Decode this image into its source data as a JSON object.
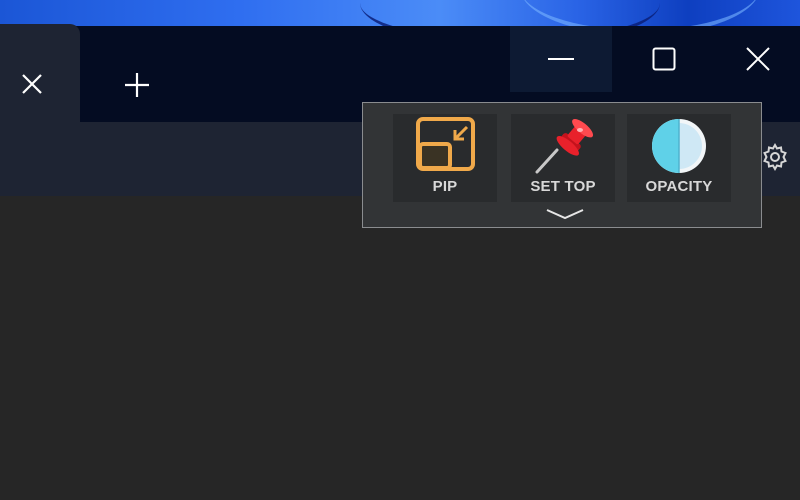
{
  "browser": {
    "tab_close_icon": "close-icon",
    "new_tab_icon": "plus-icon",
    "window_controls": {
      "minimize_icon": "minimize-icon",
      "maximize_icon": "maximize-icon",
      "close_icon": "close-icon"
    },
    "settings_icon": "gear-icon"
  },
  "popup": {
    "buttons": [
      {
        "label": "PIP",
        "icon": "pip-icon"
      },
      {
        "label": "SET TOP",
        "icon": "pushpin-icon"
      },
      {
        "label": "OPACITY",
        "icon": "half-circle-icon"
      }
    ],
    "expand_icon": "chevron-down-icon"
  },
  "colors": {
    "titlebar": "#040c22",
    "toolbar": "#1e2433",
    "content": "#262626",
    "popup_bg": "#323436",
    "pip_orange": "#f0a94a",
    "pin_red": "#e8212b",
    "opacity_cyan": "#5fd1e8"
  }
}
